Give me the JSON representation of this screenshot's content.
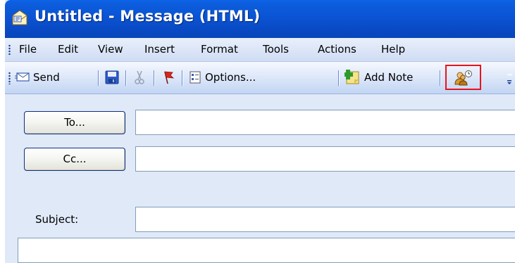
{
  "window": {
    "title": "Untitled - Message (HTML)"
  },
  "menubar": {
    "items": [
      "File",
      "Edit",
      "View",
      "Insert",
      "Format",
      "Tools",
      "Actions",
      "Help"
    ]
  },
  "toolbar": {
    "send_label": "Send",
    "options_label": "Options...",
    "add_note_label": "Add Note",
    "highlight_color": "#e8141c"
  },
  "form": {
    "to_button": "To...",
    "cc_button": "Cc...",
    "subject_label": "Subject:",
    "to_value": "",
    "cc_value": "",
    "subject_value": ""
  }
}
